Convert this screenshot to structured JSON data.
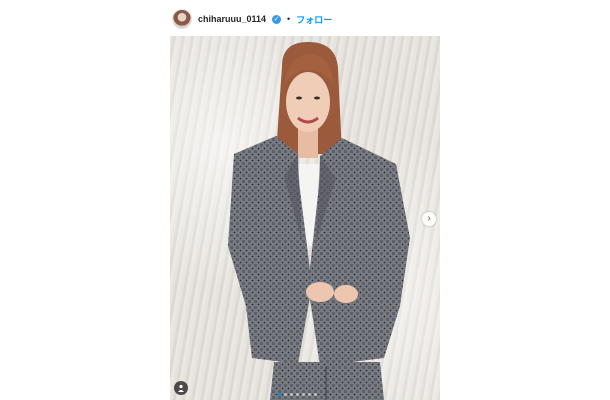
{
  "post": {
    "username": "chiharuuu_0114",
    "separator": "•",
    "follow_label": "フォロー",
    "carousel": {
      "total": 7,
      "active_index": 0
    }
  },
  "icons": {
    "verified": "verified-badge-icon",
    "next": "chevron-right-icon",
    "user_tag": "person-icon"
  },
  "colors": {
    "follow": "#0095f6",
    "verified": "#3897f0",
    "suit": "#6f7178"
  }
}
